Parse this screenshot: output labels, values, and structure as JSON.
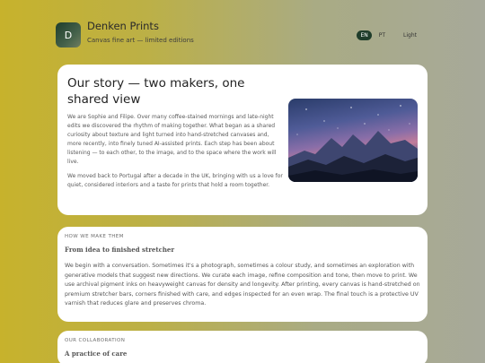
{
  "header": {
    "logo_letter": "D",
    "brand_name": "Denken Prints",
    "tagline": "Canvas fine art — limited editions",
    "languages": [
      "EN",
      "PT"
    ],
    "active_language": "EN",
    "theme_label": "Light"
  },
  "story": {
    "title": "Our story — two makers, one shared view",
    "para1": "We are Sophie and Filipe. Over many coffee-stained mornings and late-night edits we discovered the rhythm of making together. What began as a shared curiosity about texture and light turned into hand-stretched canvases and, more recently, into finely tuned AI-assisted prints. Each step has been about listening — to each other, to the image, and to the space where the work will live.",
    "para2": "We moved back to Portugal after a decade in the UK, bringing with us a love for quiet, considered interiors and a taste for prints that hold a room together."
  },
  "make": {
    "eyebrow": "HOW WE MAKE THEM",
    "title": "From idea to finished stretcher",
    "body": "We begin with a conversation. Sometimes it's a photograph, sometimes a colour study, and sometimes an exploration with generative models that suggest new directions. We curate each image, refine composition and tone, then move to print. We use archival pigment inks on heavyweight canvas for density and longevity. After printing, every canvas is hand-stretched on premium stretcher bars, corners finished with care, and edges inspected for an even wrap. The final touch is a protective UV varnish that reduces glare and preserves chroma."
  },
  "collab": {
    "eyebrow": "OUR COLLABORATION",
    "title": "A practice of care"
  },
  "colors": {
    "accent": "#1f3d2b",
    "card_bg": "#ffffff"
  }
}
